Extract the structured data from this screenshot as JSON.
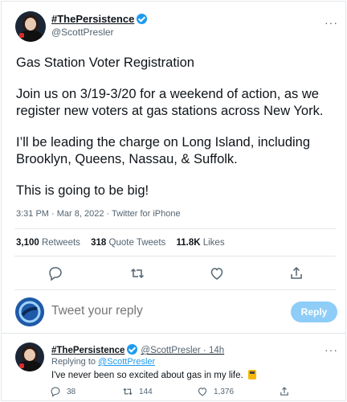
{
  "tweet": {
    "display_name": "#ThePersistence",
    "handle": "@ScottPresler",
    "paragraphs": [
      "Gas Station Voter Registration",
      "Join us on 3/19-3/20 for a weekend of action, as we register new voters at gas stations across New York.",
      "I’ll be leading the charge on Long Island, including Brooklyn, Queens, Nassau, & Suffolk.",
      "This is going to be big!"
    ],
    "timestamp": "3:31 PM · Mar 8, 2022 · Twitter for iPhone",
    "stats": {
      "retweets_count": "3,100",
      "retweets_label": "Retweets",
      "quotes_count": "318",
      "quotes_label": "Quote Tweets",
      "likes_count": "11.8K",
      "likes_label": "Likes"
    },
    "more_label": "···"
  },
  "compose": {
    "placeholder": "Tweet your reply",
    "button_label": "Reply"
  },
  "reply": {
    "display_name": "#ThePersistence",
    "handle_time": "@ScottPresler · 14h",
    "replying_label": "Replying to",
    "replying_handle": "@ScottPresler",
    "text": "I've never been so excited about gas in my life.",
    "reply_count": "38",
    "retweet_count": "144",
    "like_count": "1,376",
    "more_label": "···"
  },
  "colors": {
    "accent": "#1d9bf0",
    "text": "#0f1419",
    "muted": "#536471",
    "border": "#e3e7ea",
    "reply_button_disabled": "#8ecdf7"
  }
}
